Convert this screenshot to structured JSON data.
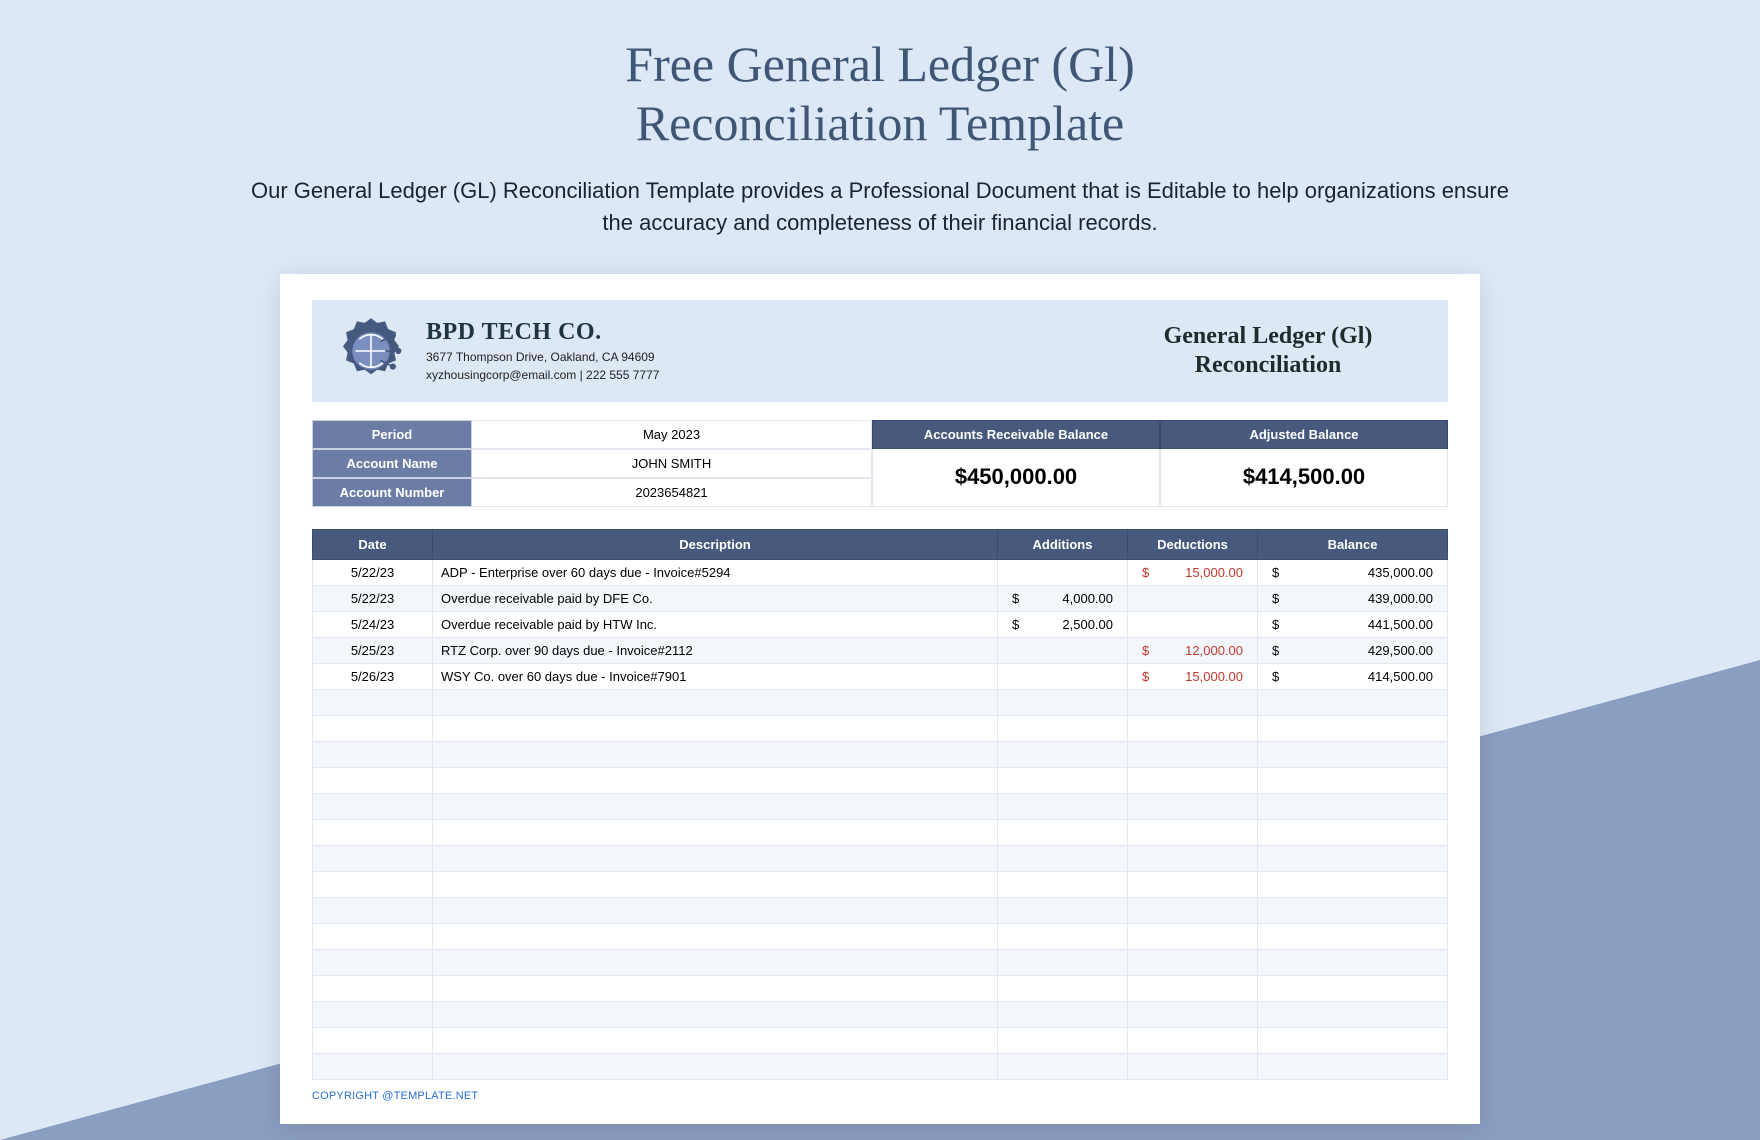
{
  "page": {
    "title_line1": "Free General Ledger (Gl)",
    "title_line2": "Reconciliation Template",
    "subtitle": "Our General Ledger (GL) Reconciliation Template provides a Professional Document that is Editable to help organizations ensure the accuracy and completeness of their financial records."
  },
  "company": {
    "name": "BPD TECH CO.",
    "address": "3677 Thompson Drive, Oakland, CA 94609",
    "contact": "xyzhousingcorp@email.com | 222 555 7777"
  },
  "ledger_title_line1": "General Ledger (Gl)",
  "ledger_title_line2": "Reconciliation",
  "summary": {
    "period_label": "Period",
    "period_value": "May 2023",
    "account_name_label": "Account Name",
    "account_name_value": "JOHN SMITH",
    "account_number_label": "Account Number",
    "account_number_value": "2023654821",
    "ar_balance_label": "Accounts Receivable Balance",
    "ar_balance_value": "$450,000.00",
    "adjusted_balance_label": "Adjusted Balance",
    "adjusted_balance_value": "$414,500.00"
  },
  "table": {
    "headers": {
      "date": "Date",
      "description": "Description",
      "additions": "Additions",
      "deductions": "Deductions",
      "balance": "Balance"
    },
    "rows": [
      {
        "date": "5/22/23",
        "description": "ADP - Enterprise over 60 days due - Invoice#5294",
        "additions": "",
        "deductions": "15,000.00",
        "balance": "435,000.00"
      },
      {
        "date": "5/22/23",
        "description": "Overdue receivable paid by DFE Co.",
        "additions": "4,000.00",
        "deductions": "",
        "balance": "439,000.00"
      },
      {
        "date": "5/24/23",
        "description": "Overdue receivable paid by HTW Inc.",
        "additions": "2,500.00",
        "deductions": "",
        "balance": "441,500.00"
      },
      {
        "date": "5/25/23",
        "description": "RTZ Corp. over 90 days due - Invoice#2112",
        "additions": "",
        "deductions": "12,000.00",
        "balance": "429,500.00"
      },
      {
        "date": "5/26/23",
        "description": "WSY Co. over 60 days due - Invoice#7901",
        "additions": "",
        "deductions": "15,000.00",
        "balance": "414,500.00"
      }
    ],
    "empty_rows": 15
  },
  "copyright": "COPYRIGHT @TEMPLATE.NET",
  "chart_data": {
    "type": "table",
    "title": "General Ledger (Gl) Reconciliation",
    "period": "May 2023",
    "account_name": "JOHN SMITH",
    "account_number": "2023654821",
    "accounts_receivable_balance": 450000.0,
    "adjusted_balance": 414500.0,
    "columns": [
      "Date",
      "Description",
      "Additions",
      "Deductions",
      "Balance"
    ],
    "rows": [
      [
        "5/22/23",
        "ADP - Enterprise over 60 days due - Invoice#5294",
        null,
        15000.0,
        435000.0
      ],
      [
        "5/22/23",
        "Overdue receivable paid by DFE Co.",
        4000.0,
        null,
        439000.0
      ],
      [
        "5/24/23",
        "Overdue receivable paid by HTW Inc.",
        2500.0,
        null,
        441500.0
      ],
      [
        "5/25/23",
        "RTZ Corp. over 90 days due - Invoice#2112",
        null,
        12000.0,
        429500.0
      ],
      [
        "5/26/23",
        "WSY Co. over 60 days due - Invoice#7901",
        null,
        15000.0,
        414500.0
      ]
    ]
  }
}
